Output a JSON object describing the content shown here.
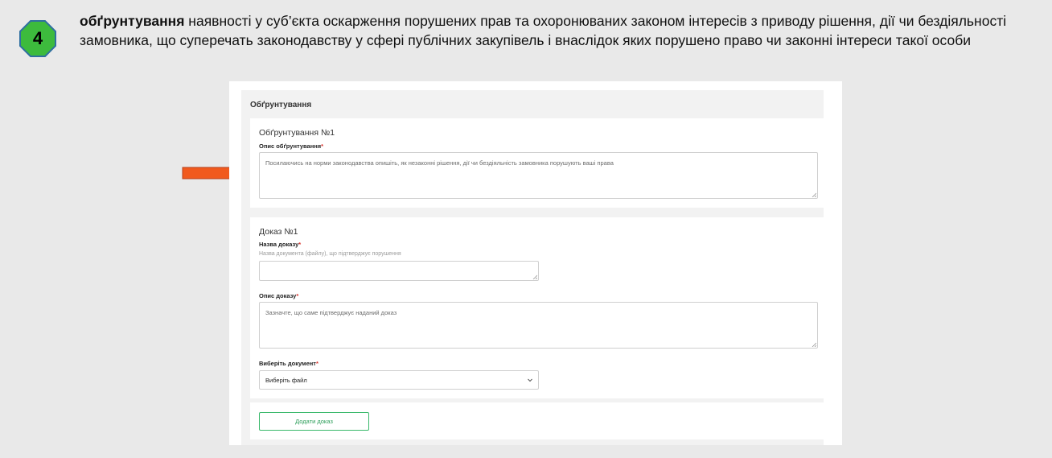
{
  "step": {
    "number": "4",
    "badge_color": "#3dbb3d",
    "keyword": "обґрунтування",
    "text": " наявності у суб’єкта оскарження порушених прав та охоронюваних законом інтересів з приводу рішення, дії чи бездіяльності замовника, що суперечать законодавству у сфері публічних закупівель і внаслідок яких порушено право чи законні інтереси такої особи"
  },
  "arrow": {
    "color": "#f15a1e",
    "icon": "arrow-right-icon"
  },
  "form": {
    "title": "Обґрунтування",
    "justification": {
      "title": "Обґрунтування №1",
      "description_label": "Опис обґрунтування",
      "description_placeholder": "Посилаючись на норми законодавства опишіть, як незаконні рішення, дії чи бездіяльність замовника порушують ваші права"
    },
    "evidence": {
      "title": "Доказ №1",
      "name_label": "Назва доказу",
      "name_hint": "Назва документа (файлу), що підтверджує порушення",
      "name_value": "",
      "description_label": "Опис доказу",
      "description_placeholder": "Зазначте, що саме підтверджує наданий доказ",
      "document_label": "Виберіть документ",
      "document_selected": "Виберіть файл"
    },
    "required_mark": "*",
    "add_evidence_label": "Додати доказ",
    "accent_color": "#39b86a"
  }
}
